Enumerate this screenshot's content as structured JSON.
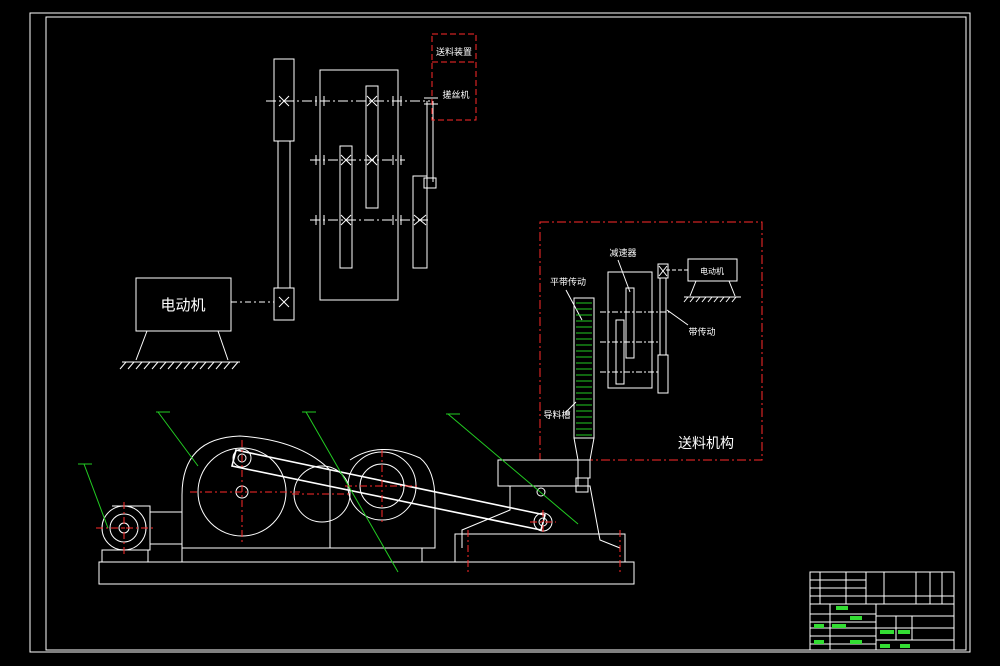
{
  "labels": {
    "motor_main": "电动机",
    "feed_device": "送料装置",
    "wire_drawing_machine": "搓丝机",
    "reducer": "减速器",
    "flat_belt": "平带传动",
    "motor_small": "电动机",
    "belt_drive": "带传动",
    "guide_groove": "导料槽",
    "feed_mechanism": "送料机构"
  },
  "colors": {
    "background": "#000000",
    "line": "#ffffff",
    "centerline": "#ff2a2a",
    "leader": "#22cc22"
  }
}
